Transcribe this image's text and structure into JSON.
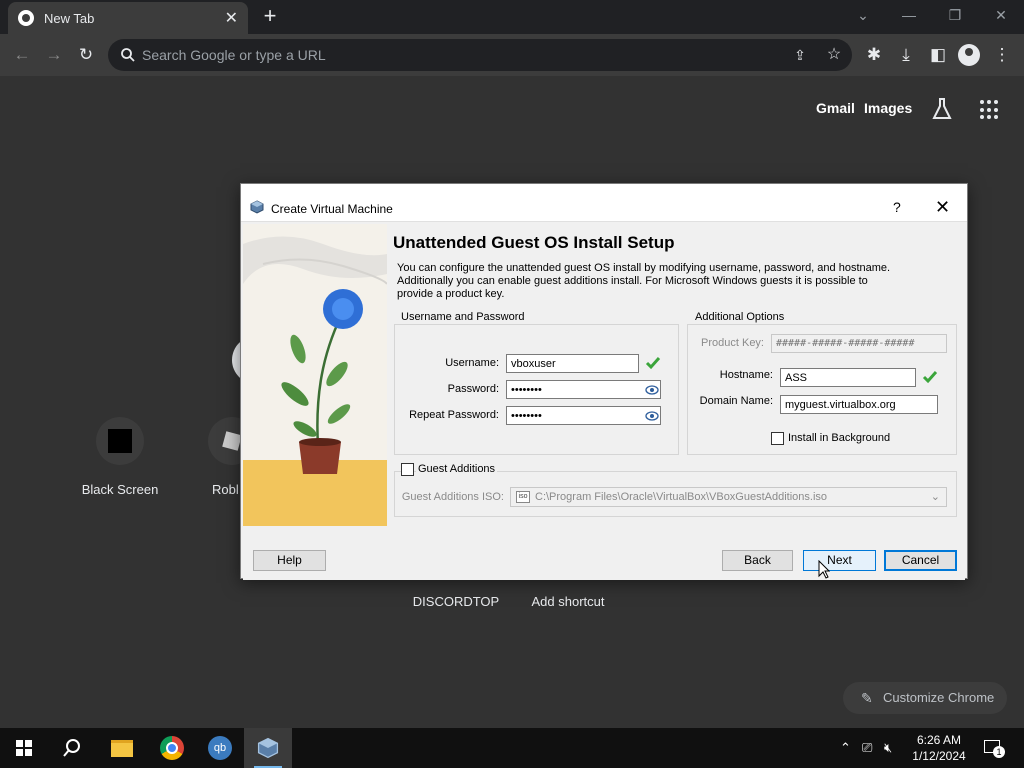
{
  "browser": {
    "tab_title": "New Tab",
    "omnibox_placeholder": "Search Google or type a URL"
  },
  "ntp": {
    "links": [
      "Gmail",
      "Images"
    ],
    "shortcuts": [
      {
        "label": "Black Screen"
      },
      {
        "label": "Robl"
      },
      {
        "label": "DISCORDTOP"
      },
      {
        "label": "Add shortcut"
      }
    ],
    "customize_label": "Customize Chrome"
  },
  "dialog": {
    "window_title": "Create Virtual Machine",
    "help_glyph": "?",
    "heading": "Unattended Guest OS Install Setup",
    "description": "You can configure the unattended guest OS install by modifying username, password, and hostname. Additionally you can enable guest additions install. For Microsoft Windows guests it is possible to provide a product key.",
    "user_group": {
      "title": "Username and Password",
      "username_label": "Username:",
      "username_value": "vboxuser",
      "password_label": "Password:",
      "password_value": "••••••••",
      "repeat_label": "Repeat Password:",
      "repeat_value": "••••••••"
    },
    "options_group": {
      "title": "Additional Options",
      "product_key_label": "Product Key:",
      "product_key_placeholder": "#####-#####-#####-#####",
      "hostname_label": "Hostname:",
      "hostname_value": "ASS",
      "domain_label": "Domain Name:",
      "domain_value": "myguest.virtualbox.org",
      "install_bg_label": "Install in Background"
    },
    "guest_additions": {
      "label": "Guest Additions",
      "iso_label": "Guest Additions ISO:",
      "iso_path": "C:\\Program Files\\Oracle\\VirtualBox\\VBoxGuestAdditions.iso"
    },
    "buttons": {
      "help": "Help",
      "back": "Back",
      "next": "Next",
      "cancel": "Cancel"
    }
  },
  "taskbar": {
    "time": "6:26 AM",
    "date": "1/12/2024",
    "notification_count": "1"
  },
  "colors": {
    "chrome_dark": "#202124",
    "accent": "#0078d7",
    "check_green": "#3ba53b"
  }
}
